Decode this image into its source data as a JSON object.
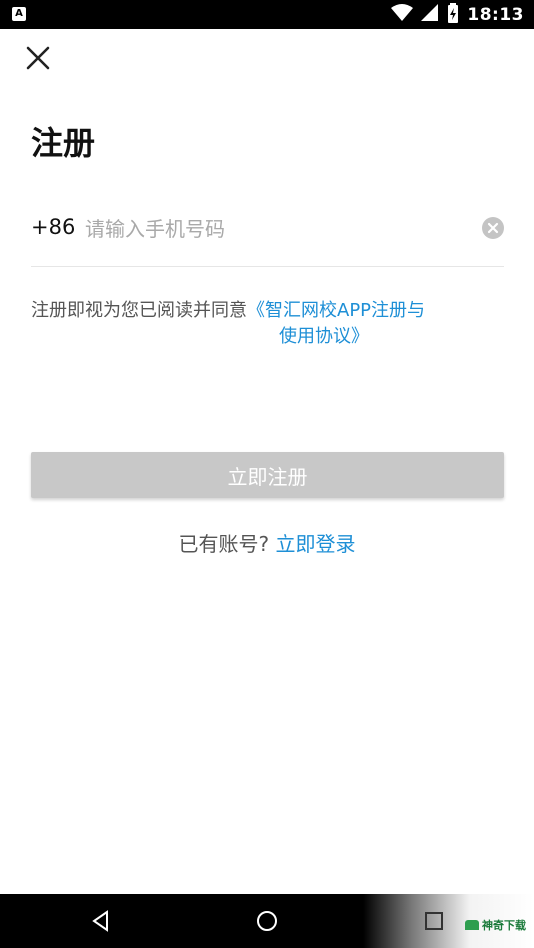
{
  "status_bar": {
    "app_badge": "A",
    "time": "18:13",
    "icons": [
      "wifi-icon",
      "signal-icon",
      "battery-icon"
    ]
  },
  "header": {
    "close_icon": "close-icon",
    "title": "注册"
  },
  "phone": {
    "country_code": "+86",
    "placeholder": "请输入手机号码",
    "value": "",
    "clear_icon": "clear-icon"
  },
  "agreement": {
    "prefix": "注册即视为您已阅读并同意",
    "link_line1": "《智汇网校APP注册与",
    "link_line2": "使用协议》"
  },
  "register_button": {
    "label": "立即注册",
    "state": "disabled"
  },
  "login": {
    "prompt": "已有账号?",
    "link": "立即登录"
  },
  "nav_bar": {
    "buttons": [
      "back-icon",
      "home-icon",
      "recents-icon"
    ],
    "watermark": "神奇下载"
  },
  "colors": {
    "link": "#1e8fd6",
    "button_disabled": "#c8c8c8",
    "status_bar": "#000000"
  }
}
